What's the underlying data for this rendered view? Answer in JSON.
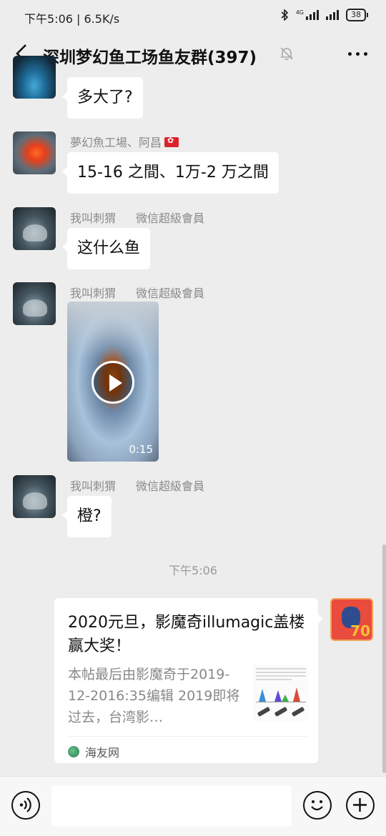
{
  "status_bar": {
    "time_speed": "下午5:06 | 6.5K/s",
    "network": "4G",
    "battery": "38"
  },
  "header": {
    "title": "深圳梦幻鱼工场鱼友群(397)"
  },
  "messages": [
    {
      "text": "多大了?"
    },
    {
      "sender": "夢幻魚工場、阿昌",
      "text": "15-16 之間、1万-2 万之間"
    },
    {
      "sender": "我叫刺猬",
      "sender_title": "微信超級會員",
      "text": "这什么鱼"
    },
    {
      "sender": "我叫刺猬",
      "sender_title": "微信超級會員",
      "video_duration": "0:15"
    },
    {
      "sender": "我叫刺猬",
      "sender_title": "微信超級會員",
      "text": "橙?"
    }
  ],
  "time_divider": "下午5:06",
  "link_card": {
    "title": "2020元旦，影魔奇illumagic盖楼赢大奖！",
    "description": "本帖最后由影魔奇于2019-12-2016:35编辑 2019即将过去，台湾影…",
    "source": "海友网"
  }
}
